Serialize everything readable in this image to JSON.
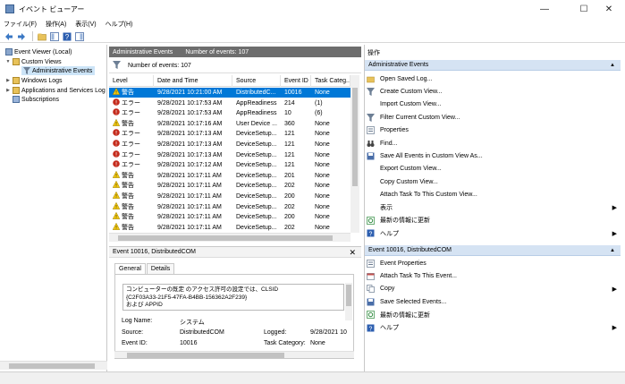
{
  "window": {
    "title": "イベント ビューアー",
    "minimize": "—",
    "maximize": "☐",
    "close": "✕"
  },
  "menu": [
    "ファイル(F)",
    "操作(A)",
    "表示(V)",
    "ヘルプ(H)"
  ],
  "tree": {
    "root": "Event Viewer (Local)",
    "custom_views": "Custom Views",
    "admin_events": "Administrative Events",
    "windows_logs": "Windows Logs",
    "apps_services": "Applications and Services Log",
    "subscriptions": "Subscriptions"
  },
  "center": {
    "view_name": "Administrative Events",
    "event_count_header": "Number of events: 107",
    "filter_text": "Number of events: 107",
    "columns": [
      "Level",
      "Date and Time",
      "Source",
      "Event ID",
      "Task Categ..."
    ],
    "rows": [
      {
        "level": "警告",
        "type": "warn",
        "date": "9/28/2021 10:21:00 AM",
        "source": "DistributedC...",
        "id": "10016",
        "task": "None"
      },
      {
        "level": "エラー",
        "type": "err",
        "date": "9/28/2021 10:17:53 AM",
        "source": "AppReadiness",
        "id": "214",
        "task": "(1)"
      },
      {
        "level": "エラー",
        "type": "err",
        "date": "9/28/2021 10:17:53 AM",
        "source": "AppReadiness",
        "id": "10",
        "task": "(6)"
      },
      {
        "level": "警告",
        "type": "warn",
        "date": "9/28/2021 10:17:16 AM",
        "source": "User Device ...",
        "id": "360",
        "task": "None"
      },
      {
        "level": "エラー",
        "type": "err",
        "date": "9/28/2021 10:17:13 AM",
        "source": "DeviceSetup...",
        "id": "121",
        "task": "None"
      },
      {
        "level": "エラー",
        "type": "err",
        "date": "9/28/2021 10:17:13 AM",
        "source": "DeviceSetup...",
        "id": "121",
        "task": "None"
      },
      {
        "level": "エラー",
        "type": "err",
        "date": "9/28/2021 10:17:13 AM",
        "source": "DeviceSetup...",
        "id": "121",
        "task": "None"
      },
      {
        "level": "エラー",
        "type": "err",
        "date": "9/28/2021 10:17:12 AM",
        "source": "DeviceSetup...",
        "id": "121",
        "task": "None"
      },
      {
        "level": "警告",
        "type": "warn",
        "date": "9/28/2021 10:17:11 AM",
        "source": "DeviceSetup...",
        "id": "201",
        "task": "None"
      },
      {
        "level": "警告",
        "type": "warn",
        "date": "9/28/2021 10:17:11 AM",
        "source": "DeviceSetup...",
        "id": "202",
        "task": "None"
      },
      {
        "level": "警告",
        "type": "warn",
        "date": "9/28/2021 10:17:11 AM",
        "source": "DeviceSetup...",
        "id": "200",
        "task": "None"
      },
      {
        "level": "警告",
        "type": "warn",
        "date": "9/28/2021 10:17:11 AM",
        "source": "DeviceSetup...",
        "id": "202",
        "task": "None"
      },
      {
        "level": "警告",
        "type": "warn",
        "date": "9/28/2021 10:17:11 AM",
        "source": "DeviceSetup...",
        "id": "200",
        "task": "None"
      },
      {
        "level": "警告",
        "type": "warn",
        "date": "9/28/2021 10:17:11 AM",
        "source": "DeviceSetup...",
        "id": "202",
        "task": "None"
      }
    ]
  },
  "detail": {
    "title": "Event 10016, DistributedCOM",
    "close": "✕",
    "tabs": [
      "General",
      "Details"
    ],
    "description_lines": [
      "コンピューターの既定 のアクセス許可の設定では、CLSID",
      "{C2F03A33-21F5-47FA-B4BB-156362A2F239}",
      "および APPID"
    ],
    "log_name_label": "Log Name:",
    "log_name": "システム",
    "source_label": "Source:",
    "source": "DistributedCOM",
    "logged_label": "Logged:",
    "logged": "9/28/2021 10",
    "event_id_label": "Event ID:",
    "event_id": "10016",
    "task_label": "Task Category:",
    "task": "None"
  },
  "actions": {
    "title": "操作",
    "section1": "Administrative Events",
    "items1": [
      {
        "label": "Open Saved Log...",
        "icon": "folder-open-icon",
        "sub": ""
      },
      {
        "label": "Create Custom View...",
        "icon": "filter-icon",
        "sub": ""
      },
      {
        "label": "Import Custom View...",
        "icon": "",
        "sub": ""
      },
      {
        "label": "Filter Current Custom View...",
        "icon": "filter-icon",
        "sub": ""
      },
      {
        "label": "Properties",
        "icon": "properties-icon",
        "sub": ""
      },
      {
        "label": "Find...",
        "icon": "binoculars-icon",
        "sub": ""
      },
      {
        "label": "Save All Events in Custom View As...",
        "icon": "save-icon",
        "sub": ""
      },
      {
        "label": "Export Custom View...",
        "icon": "",
        "sub": ""
      },
      {
        "label": "Copy Custom View...",
        "icon": "",
        "sub": ""
      },
      {
        "label": "Attach Task To This Custom View...",
        "icon": "",
        "sub": ""
      },
      {
        "label": "表示",
        "icon": "",
        "sub": "▶"
      },
      {
        "label": "最新の情報に更新",
        "icon": "refresh-icon",
        "sub": ""
      },
      {
        "label": "ヘルプ",
        "icon": "help-icon",
        "sub": "▶"
      }
    ],
    "section2": "Event 10016, DistributedCOM",
    "items2": [
      {
        "label": "Event Properties",
        "icon": "properties-icon",
        "sub": ""
      },
      {
        "label": "Attach Task To This Event...",
        "icon": "task-icon",
        "sub": ""
      },
      {
        "label": "Copy",
        "icon": "copy-icon",
        "sub": "▶"
      },
      {
        "label": "Save Selected Events...",
        "icon": "save-icon",
        "sub": ""
      },
      {
        "label": "最新の情報に更新",
        "icon": "refresh-icon",
        "sub": ""
      },
      {
        "label": "ヘルプ",
        "icon": "help-icon",
        "sub": "▶"
      }
    ]
  },
  "colors": {
    "selection": "#0078d7",
    "header_bar": "#6d6d6d",
    "action_section": "#d5e3f3",
    "error": "#c42b1c",
    "warning": "#f2c811"
  }
}
